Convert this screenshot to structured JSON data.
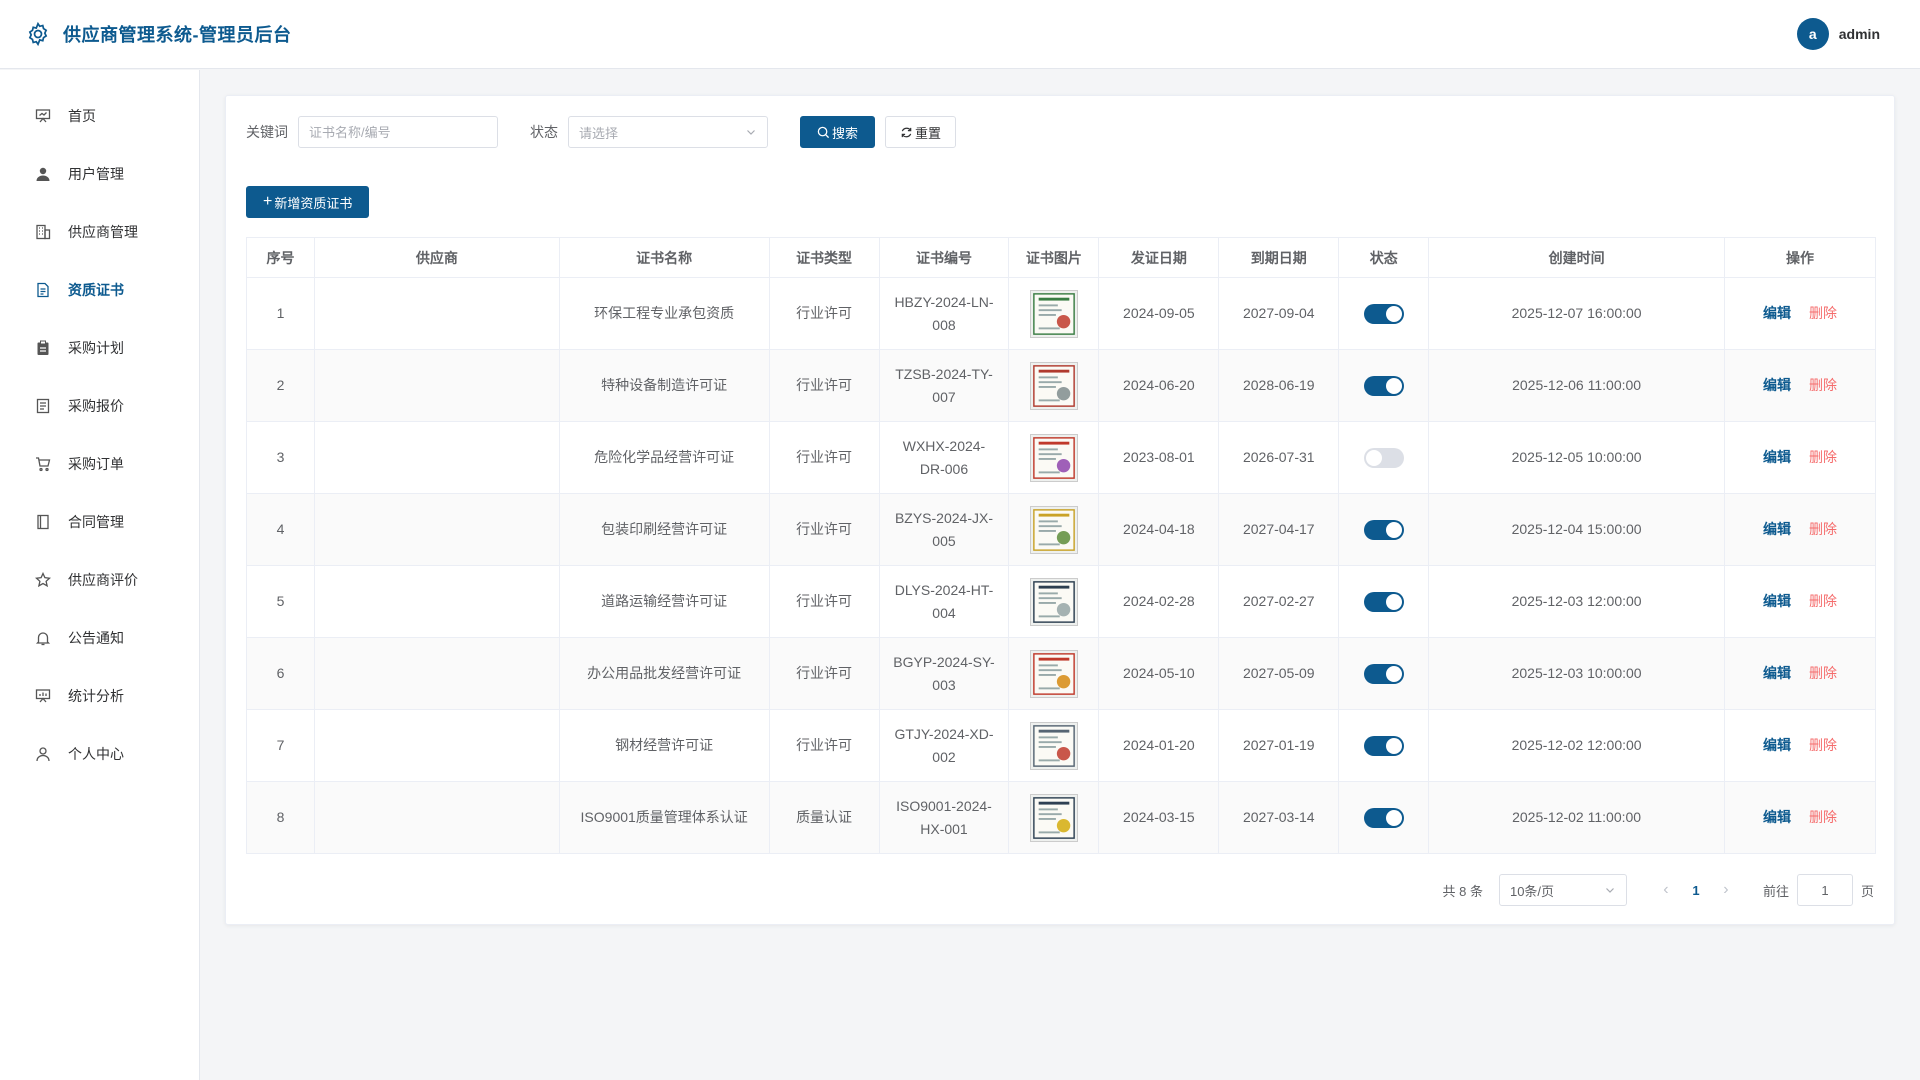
{
  "header": {
    "title": "供应商管理系统-管理员后台",
    "user": {
      "avatar_letter": "a",
      "name": "admin"
    }
  },
  "sidebar": {
    "items": [
      {
        "label": "首页",
        "icon": "dashboard-icon"
      },
      {
        "label": "用户管理",
        "icon": "user-icon"
      },
      {
        "label": "供应商管理",
        "icon": "building-icon"
      },
      {
        "label": "资质证书",
        "icon": "document-icon",
        "active": true
      },
      {
        "label": "采购计划",
        "icon": "clipboard-icon"
      },
      {
        "label": "采购报价",
        "icon": "list-icon"
      },
      {
        "label": "采购订单",
        "icon": "cart-icon"
      },
      {
        "label": "合同管理",
        "icon": "notebook-icon"
      },
      {
        "label": "供应商评价",
        "icon": "star-icon"
      },
      {
        "label": "公告通知",
        "icon": "bell-icon"
      },
      {
        "label": "统计分析",
        "icon": "chart-icon"
      },
      {
        "label": "个人中心",
        "icon": "person-icon"
      }
    ]
  },
  "filter": {
    "keyword_label": "关键词",
    "keyword_placeholder": "证书名称/编号",
    "keyword_value": "",
    "status_label": "状态",
    "status_placeholder": "请选择",
    "search_label": "搜索",
    "reset_label": "重置"
  },
  "add_button": "新增资质证书",
  "table": {
    "columns": [
      "序号",
      "供应商",
      "证书名称",
      "证书类型",
      "证书编号",
      "证书图片",
      "发证日期",
      "到期日期",
      "状态",
      "创建时间",
      "操作"
    ],
    "edit_label": "编辑",
    "delete_label": "删除",
    "rows": [
      {
        "index": "1",
        "supplier": "",
        "name": "环保工程专业承包资质",
        "type": "行业许可",
        "code_line1": "HBZY-2024-LN-",
        "code_line2": "008",
        "issue": "2024-09-05",
        "expire": "2027-09-04",
        "status": true,
        "created": "2025-12-07 16:00:00"
      },
      {
        "index": "2",
        "supplier": "",
        "name": "特种设备制造许可证",
        "type": "行业许可",
        "code_line1": "TZSB-2024-TY-",
        "code_line2": "007",
        "issue": "2024-06-20",
        "expire": "2028-06-19",
        "status": true,
        "created": "2025-12-06 11:00:00"
      },
      {
        "index": "3",
        "supplier": "",
        "name": "危险化学品经营许可证",
        "type": "行业许可",
        "code_line1": "WXHX-2024-",
        "code_line2": "DR-006",
        "issue": "2023-08-01",
        "expire": "2026-07-31",
        "status": false,
        "created": "2025-12-05 10:00:00"
      },
      {
        "index": "4",
        "supplier": "",
        "name": "包装印刷经营许可证",
        "type": "行业许可",
        "code_line1": "BZYS-2024-JX-",
        "code_line2": "005",
        "issue": "2024-04-18",
        "expire": "2027-04-17",
        "status": true,
        "created": "2025-12-04 15:00:00"
      },
      {
        "index": "5",
        "supplier": "",
        "name": "道路运输经营许可证",
        "type": "行业许可",
        "code_line1": "DLYS-2024-HT-",
        "code_line2": "004",
        "issue": "2024-02-28",
        "expire": "2027-02-27",
        "status": true,
        "created": "2025-12-03 12:00:00"
      },
      {
        "index": "6",
        "supplier": "",
        "name": "办公用品批发经营许可证",
        "type": "行业许可",
        "code_line1": "BGYP-2024-SY-",
        "code_line2": "003",
        "issue": "2024-05-10",
        "expire": "2027-05-09",
        "status": true,
        "created": "2025-12-03 10:00:00"
      },
      {
        "index": "7",
        "supplier": "",
        "name": "钢材经营许可证",
        "type": "行业许可",
        "code_line1": "GTJY-2024-XD-",
        "code_line2": "002",
        "issue": "2024-01-20",
        "expire": "2027-01-19",
        "status": true,
        "created": "2025-12-02 12:00:00"
      },
      {
        "index": "8",
        "supplier": "",
        "name": "ISO9001质量管理体系认证",
        "type": "质量认证",
        "code_line1": "ISO9001-2024-",
        "code_line2": "HX-001",
        "issue": "2024-03-15",
        "expire": "2027-03-14",
        "status": true,
        "created": "2025-12-02 11:00:00"
      }
    ]
  },
  "pagination": {
    "total_text": "共 8 条",
    "page_size": "10条/页",
    "current_page": "1",
    "goto_label": "前往",
    "goto_value": "1",
    "page_suffix": "页"
  },
  "colors": {
    "primary": "#0d5a8f",
    "danger": "#f56c6c",
    "switch_off": "#dcdfe6"
  }
}
